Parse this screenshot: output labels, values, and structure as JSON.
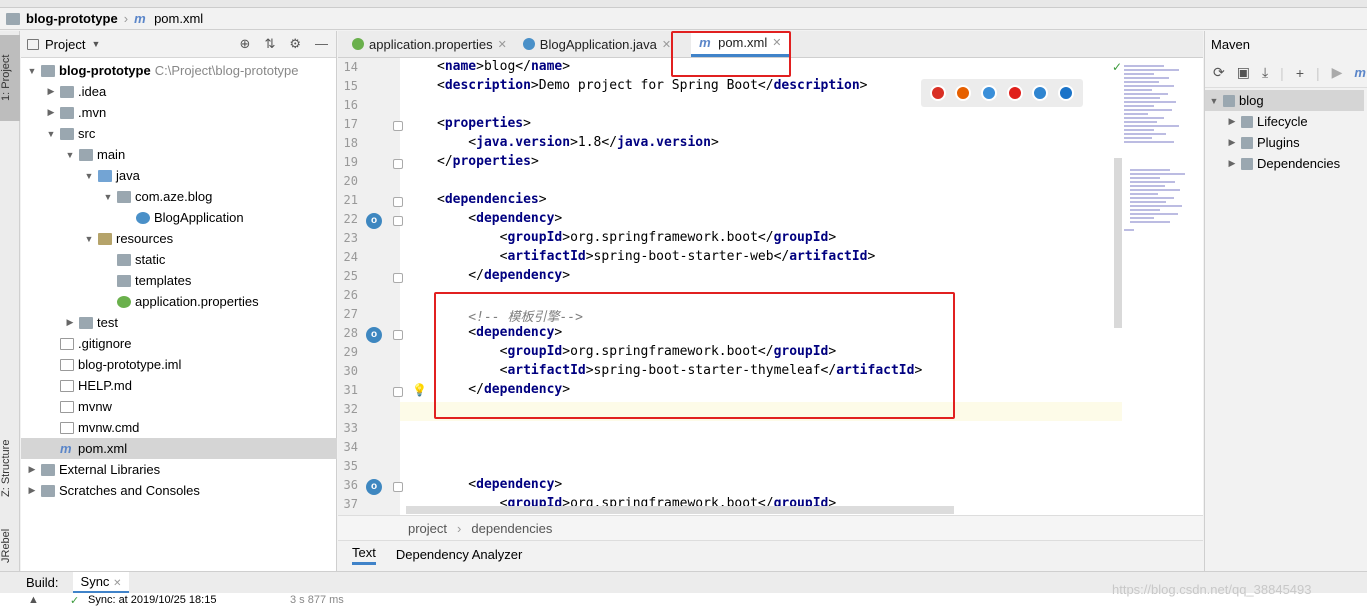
{
  "breadcrumb": {
    "project": "blog-prototype",
    "file": "pom.xml",
    "file_icon": "maven-m-icon"
  },
  "left_stripe": {
    "project_tab": "1: Project",
    "structure_tab": "Z: Structure",
    "jrebel_tab": "JRebel"
  },
  "project_panel": {
    "title": "Project",
    "tree": [
      {
        "label": "blog-prototype",
        "path": "C:\\Project\\blog-prototype",
        "icon": "folder-icon",
        "arrow": "v"
      },
      {
        "label": ".idea",
        "icon": "folder-icon",
        "arrow": ">"
      },
      {
        "label": ".mvn",
        "icon": "folder-icon",
        "arrow": ">"
      },
      {
        "label": "src",
        "icon": "folder-icon",
        "arrow": "v"
      },
      {
        "label": "main",
        "icon": "folder-icon",
        "arrow": "v"
      },
      {
        "label": "java",
        "icon": "source-folder-icon",
        "arrow": "v"
      },
      {
        "label": "com.aze.blog",
        "icon": "package-icon",
        "arrow": "v"
      },
      {
        "label": "BlogApplication",
        "icon": "spring-class-icon",
        "arrow": ""
      },
      {
        "label": "resources",
        "icon": "resources-folder-icon",
        "arrow": "v"
      },
      {
        "label": "static",
        "icon": "folder-icon",
        "arrow": ""
      },
      {
        "label": "templates",
        "icon": "folder-icon",
        "arrow": ""
      },
      {
        "label": "application.properties",
        "icon": "spring-properties-icon",
        "arrow": ""
      },
      {
        "label": "test",
        "icon": "folder-icon",
        "arrow": ">"
      },
      {
        "label": ".gitignore",
        "icon": "file-icon",
        "arrow": ""
      },
      {
        "label": "blog-prototype.iml",
        "icon": "file-icon",
        "arrow": ""
      },
      {
        "label": "HELP.md",
        "icon": "markdown-icon",
        "arrow": ""
      },
      {
        "label": "mvnw",
        "icon": "shell-icon",
        "arrow": ""
      },
      {
        "label": "mvnw.cmd",
        "icon": "file-icon",
        "arrow": ""
      },
      {
        "label": "pom.xml",
        "icon": "maven-m-icon",
        "arrow": ""
      },
      {
        "label": "External Libraries",
        "icon": "library-icon",
        "arrow": ">"
      },
      {
        "label": "Scratches and Consoles",
        "icon": "scratch-icon",
        "arrow": ">"
      }
    ]
  },
  "tabs": [
    {
      "label": "application.properties",
      "icon": "spring-properties-icon"
    },
    {
      "label": "BlogApplication.java",
      "icon": "spring-class-icon"
    },
    {
      "label": "pom.xml",
      "icon": "maven-m-icon",
      "active": true
    }
  ],
  "editor": {
    "lines": [
      {
        "n": "14",
        "text": "<name>blog</name>"
      },
      {
        "n": "15",
        "text": "<description>Demo project for Spring Boot</description>"
      },
      {
        "n": "16",
        "text": ""
      },
      {
        "n": "17",
        "text": "<properties>"
      },
      {
        "n": "18",
        "text": "    <java.version>1.8</java.version>"
      },
      {
        "n": "19",
        "text": "</properties>"
      },
      {
        "n": "20",
        "text": ""
      },
      {
        "n": "21",
        "text": "<dependencies>"
      },
      {
        "n": "22",
        "text": "    <dependency>"
      },
      {
        "n": "23",
        "text": "        <groupId>org.springframework.boot</groupId>"
      },
      {
        "n": "24",
        "text": "        <artifactId>spring-boot-starter-web</artifactId>"
      },
      {
        "n": "25",
        "text": "    </dependency>"
      },
      {
        "n": "26",
        "text": ""
      },
      {
        "n": "27",
        "text": "    <!-- 模板引擎-->"
      },
      {
        "n": "28",
        "text": "    <dependency>"
      },
      {
        "n": "29",
        "text": "        <groupId>org.springframework.boot</groupId>"
      },
      {
        "n": "30",
        "text": "        <artifactId>spring-boot-starter-thymeleaf</artifactId>"
      },
      {
        "n": "31",
        "text": "    </dependency>"
      },
      {
        "n": "32",
        "text": ""
      },
      {
        "n": "33",
        "text": ""
      },
      {
        "n": "34",
        "text": ""
      },
      {
        "n": "35",
        "text": ""
      },
      {
        "n": "36",
        "text": "    <dependency>"
      },
      {
        "n": "37",
        "text": "        <groupId>org.springframework.boot</groupId>"
      }
    ],
    "breadcrumb": [
      "project",
      "dependencies"
    ],
    "bottom_tabs": [
      "Text",
      "Dependency Analyzer"
    ]
  },
  "browser_icons": [
    "chrome-icon",
    "firefox-icon",
    "safari-icon",
    "opera-icon",
    "ie-icon",
    "edge-icon"
  ],
  "maven_panel": {
    "title": "Maven",
    "tree": [
      {
        "label": "blog",
        "arrow": "v"
      },
      {
        "label": "Lifecycle",
        "arrow": ">"
      },
      {
        "label": "Plugins",
        "arrow": ">"
      },
      {
        "label": "Dependencies",
        "arrow": ">"
      }
    ]
  },
  "build_bar": {
    "build_label": "Build:",
    "sync_tab": "Sync",
    "sync_line": "Sync: at 2019/10/25 18:15",
    "duration": "3 s 877 ms"
  },
  "watermark": "https://blog.csdn.net/qq_38845493",
  "colors": {
    "accent": "#4083c9",
    "highlight_box": "#e12020",
    "xml_tag": "#000080"
  }
}
